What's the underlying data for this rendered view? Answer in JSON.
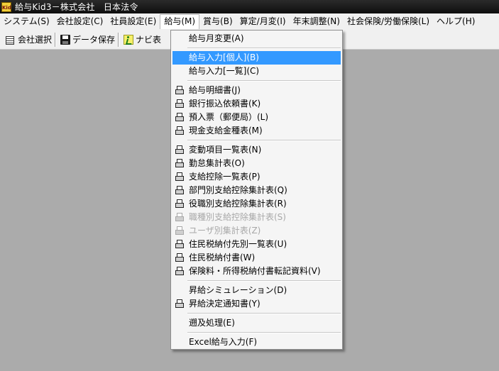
{
  "window": {
    "title": "給与Kid3－株式会社　日本法令",
    "icon": "app-logo-icon",
    "icon_text": "Kid"
  },
  "menubar": [
    {
      "label": "システム(S)"
    },
    {
      "label": "会社設定(C)"
    },
    {
      "label": "社員設定(E)"
    },
    {
      "label": "給与(M)",
      "active": true
    },
    {
      "label": "賞与(B)"
    },
    {
      "label": "算定/月変(I)"
    },
    {
      "label": "年末調整(N)"
    },
    {
      "label": "社会保険/労働保険(L)"
    },
    {
      "label": "ヘルプ(H)"
    }
  ],
  "toolbar": {
    "company_select": "会社選択",
    "data_save": "データ保存",
    "navi": "ナビ表"
  },
  "dropdown": {
    "items": [
      {
        "label": "給与月変更(A)"
      },
      {
        "sep": true
      },
      {
        "label": "給与入力[個人](B)",
        "highlight": true
      },
      {
        "label": "給与入力[一覧](C)"
      },
      {
        "sep": true
      },
      {
        "label": "給与明細書(J)",
        "icon": "printer-icon"
      },
      {
        "label": "銀行振込依頼書(K)",
        "icon": "printer-icon"
      },
      {
        "label": "預入票（郵便局）(L)",
        "icon": "printer-icon"
      },
      {
        "label": "現金支給金種表(M)",
        "icon": "printer-icon"
      },
      {
        "sep": true
      },
      {
        "label": "変動項目一覧表(N)",
        "icon": "printer-icon"
      },
      {
        "label": "勤怠集計表(O)",
        "icon": "printer-icon"
      },
      {
        "label": "支給控除一覧表(P)",
        "icon": "printer-icon"
      },
      {
        "label": "部門別支給控除集計表(Q)",
        "icon": "printer-icon"
      },
      {
        "label": "役職別支給控除集計表(R)",
        "icon": "printer-icon"
      },
      {
        "label": "職種別支給控除集計表(S)",
        "icon": "printer-icon",
        "disabled": true
      },
      {
        "label": "ユーザ別集計表(Z)",
        "icon": "printer-icon",
        "disabled": true
      },
      {
        "label": "住民税納付先別一覧表(U)",
        "icon": "printer-icon"
      },
      {
        "label": "住民税納付書(W)",
        "icon": "printer-icon"
      },
      {
        "label": "保険料・所得税納付書転記資料(V)",
        "icon": "printer-icon"
      },
      {
        "sep": true
      },
      {
        "label": "昇給シミュレーション(D)"
      },
      {
        "label": "昇給決定通知書(Y)",
        "icon": "printer-icon"
      },
      {
        "sep": true
      },
      {
        "label": "遡及処理(E)"
      },
      {
        "sep": true
      },
      {
        "label": "Excel給与入力(F)"
      }
    ]
  }
}
